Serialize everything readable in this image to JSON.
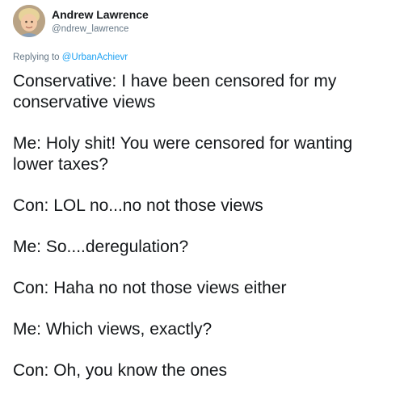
{
  "author": {
    "name": "Andrew Lawrence",
    "handle": "@ndrew_lawrence",
    "avatar_icon": "user-avatar-photo"
  },
  "reply": {
    "prefix": "Replying to ",
    "mention": "@UrbanAchievr"
  },
  "tweet": {
    "paragraphs": [
      "Conservative: I have been censored for my conservative views",
      "Me: Holy shit! You were censored for wanting lower taxes?",
      "Con: LOL no...no not those views",
      "Me: So....deregulation?",
      "Con: Haha no not those views either",
      "Me: Which views, exactly?",
      "Con: Oh, you know the ones"
    ]
  },
  "colors": {
    "text": "#14171a",
    "secondary": "#657786",
    "link": "#1da1f2"
  }
}
